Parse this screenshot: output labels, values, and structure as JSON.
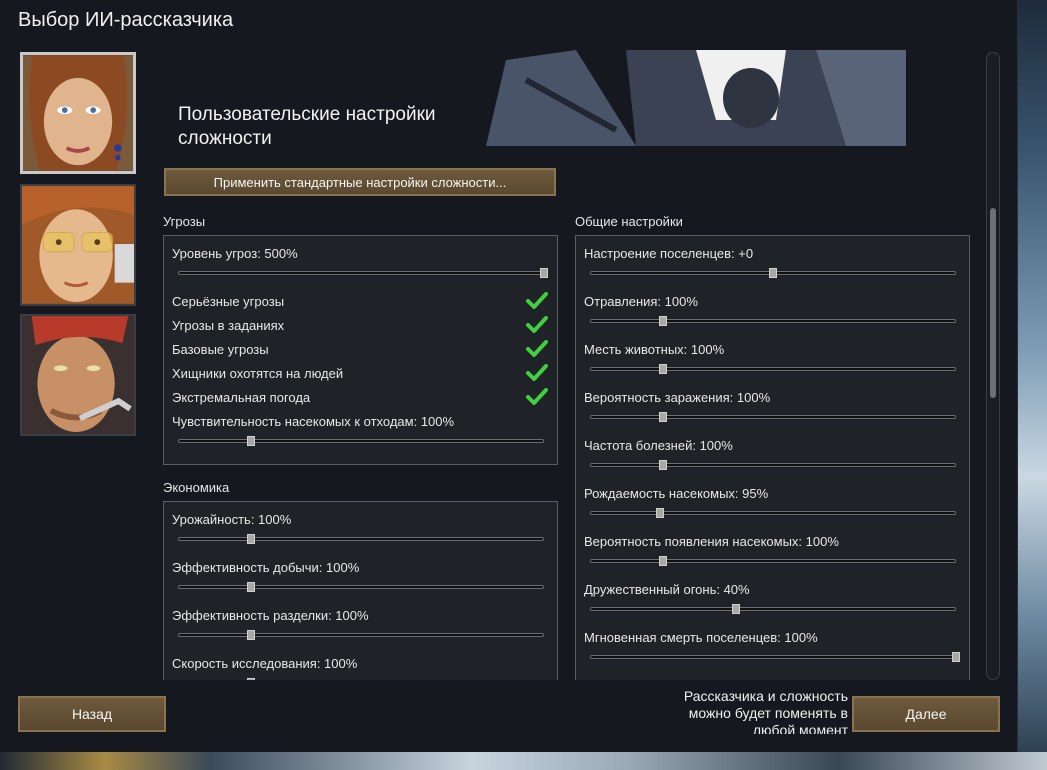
{
  "window": {
    "title": "Выбор ИИ-рассказчика"
  },
  "settings": {
    "heading": "Пользовательские настройки сложности",
    "apply_label": "Применить стандартные настройки сложности..."
  },
  "threats": {
    "label": "Угрозы",
    "threat_level": {
      "label": "Уровень угроз: 500%",
      "value_pct": 100
    },
    "toggles": [
      {
        "label": "Серьёзные угрозы",
        "checked": true
      },
      {
        "label": "Угрозы в заданиях",
        "checked": true
      },
      {
        "label": "Базовые угрозы",
        "checked": true
      },
      {
        "label": "Хищники охотятся на людей",
        "checked": true
      },
      {
        "label": "Экстремальная погода",
        "checked": true
      }
    ],
    "insect_sensitivity": {
      "label": "Чувствительность насекомых к отходам: 100%",
      "value_pct": 20
    }
  },
  "economy": {
    "label": "Экономика",
    "items": [
      {
        "label": "Урожайность: 100%",
        "value_pct": 20
      },
      {
        "label": "Эффективность добычи: 100%",
        "value_pct": 20
      },
      {
        "label": "Эффективность разделки: 100%",
        "value_pct": 20
      },
      {
        "label": "Скорость исследования: 100%",
        "value_pct": 20
      }
    ]
  },
  "general": {
    "label": "Общие настройки",
    "items": [
      {
        "label": "Настроение поселенцев: +0",
        "value_pct": 50
      },
      {
        "label": "Отравления: 100%",
        "value_pct": 20
      },
      {
        "label": "Месть животных: 100%",
        "value_pct": 20
      },
      {
        "label": "Вероятность заражения: 100%",
        "value_pct": 20
      },
      {
        "label": "Частота болезней: 100%",
        "value_pct": 20
      },
      {
        "label": "Рождаемость насекомых: 95%",
        "value_pct": 19
      },
      {
        "label": "Вероятность появления насекомых: 100%",
        "value_pct": 20
      },
      {
        "label": "Дружественный огонь: 40%",
        "value_pct": 40
      },
      {
        "label": "Мгновенная смерть поселенцев: 100%",
        "value_pct": 100
      }
    ]
  },
  "footer": {
    "back_label": "Назад",
    "next_label": "Далее",
    "note_lines": [
      "Рассказчика и сложность",
      "можно будет поменять в",
      "любой момент"
    ]
  },
  "colors": {
    "button": "#5f4d33",
    "check": "#3fcf3f",
    "panel": "#1f2226"
  }
}
